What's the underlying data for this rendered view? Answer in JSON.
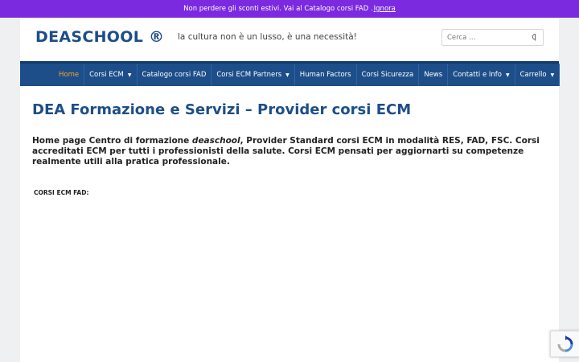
{
  "promo": {
    "text": "Non perdere gli sconti estivi. Vai al Catalogo corsi FAD .",
    "dismiss_label": "Ignora"
  },
  "header": {
    "logo": "DEASCHOOL ®",
    "tagline": "la cultura non è un lusso, è una necessità!",
    "search_placeholder": "Cerca …"
  },
  "nav": {
    "items": [
      {
        "label": "Home",
        "active": true,
        "dropdown": false
      },
      {
        "label": "Corsi ECM",
        "active": false,
        "dropdown": true
      },
      {
        "label": "Catalogo corsi FAD",
        "active": false,
        "dropdown": false
      },
      {
        "label": "Corsi ECM Partners",
        "active": false,
        "dropdown": true
      },
      {
        "label": "Human Factors",
        "active": false,
        "dropdown": false
      },
      {
        "label": "Corsi Sicurezza",
        "active": false,
        "dropdown": false
      },
      {
        "label": "News",
        "active": false,
        "dropdown": false
      },
      {
        "label": "Contatti e Info",
        "active": false,
        "dropdown": true
      },
      {
        "label": "Carrello",
        "active": false,
        "dropdown": true
      }
    ]
  },
  "main": {
    "title": "DEA Formazione e Servizi – Provider corsi ECM",
    "intro_before": "Home page Centro di formazione ",
    "intro_brand": "deaschool",
    "intro_after": ", Provider Standard corsi ECM in modalità RES, FAD, FSC. Corsi accreditati ECM per tutti i professionisti della salute. Corsi ECM pensati per aggiornarti su competenze realmente utili alla pratica professionale.",
    "section_label": "CORSI ECM FAD:"
  },
  "colors": {
    "promo_bg": "#7b2ae0",
    "brand_blue": "#1d4e89",
    "nav_active": "#f5a623"
  }
}
